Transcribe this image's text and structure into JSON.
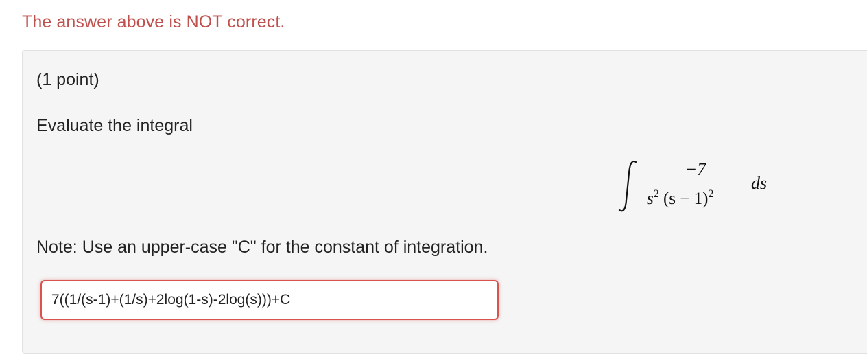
{
  "feedback": {
    "message": "The answer above is NOT correct."
  },
  "problem": {
    "points": "(1 point)",
    "prompt": "Evaluate the integral",
    "integral": {
      "numerator": "−7",
      "denominator_base": "s",
      "denominator_exp": "2",
      "denominator_rest": " (s − 1)",
      "denominator_rest_exp": "2",
      "differential": "ds"
    },
    "note": "Note: Use an upper-case \"C\" for the constant of integration."
  },
  "answer": {
    "value": "7((1/(s-1)+(1/s)+2log(1-s)-2log(s)))+C",
    "status": "incorrect",
    "border_color": "#d9534f"
  },
  "colors": {
    "feedback_error": "#c0504d",
    "panel_bg": "#f5f5f5"
  }
}
